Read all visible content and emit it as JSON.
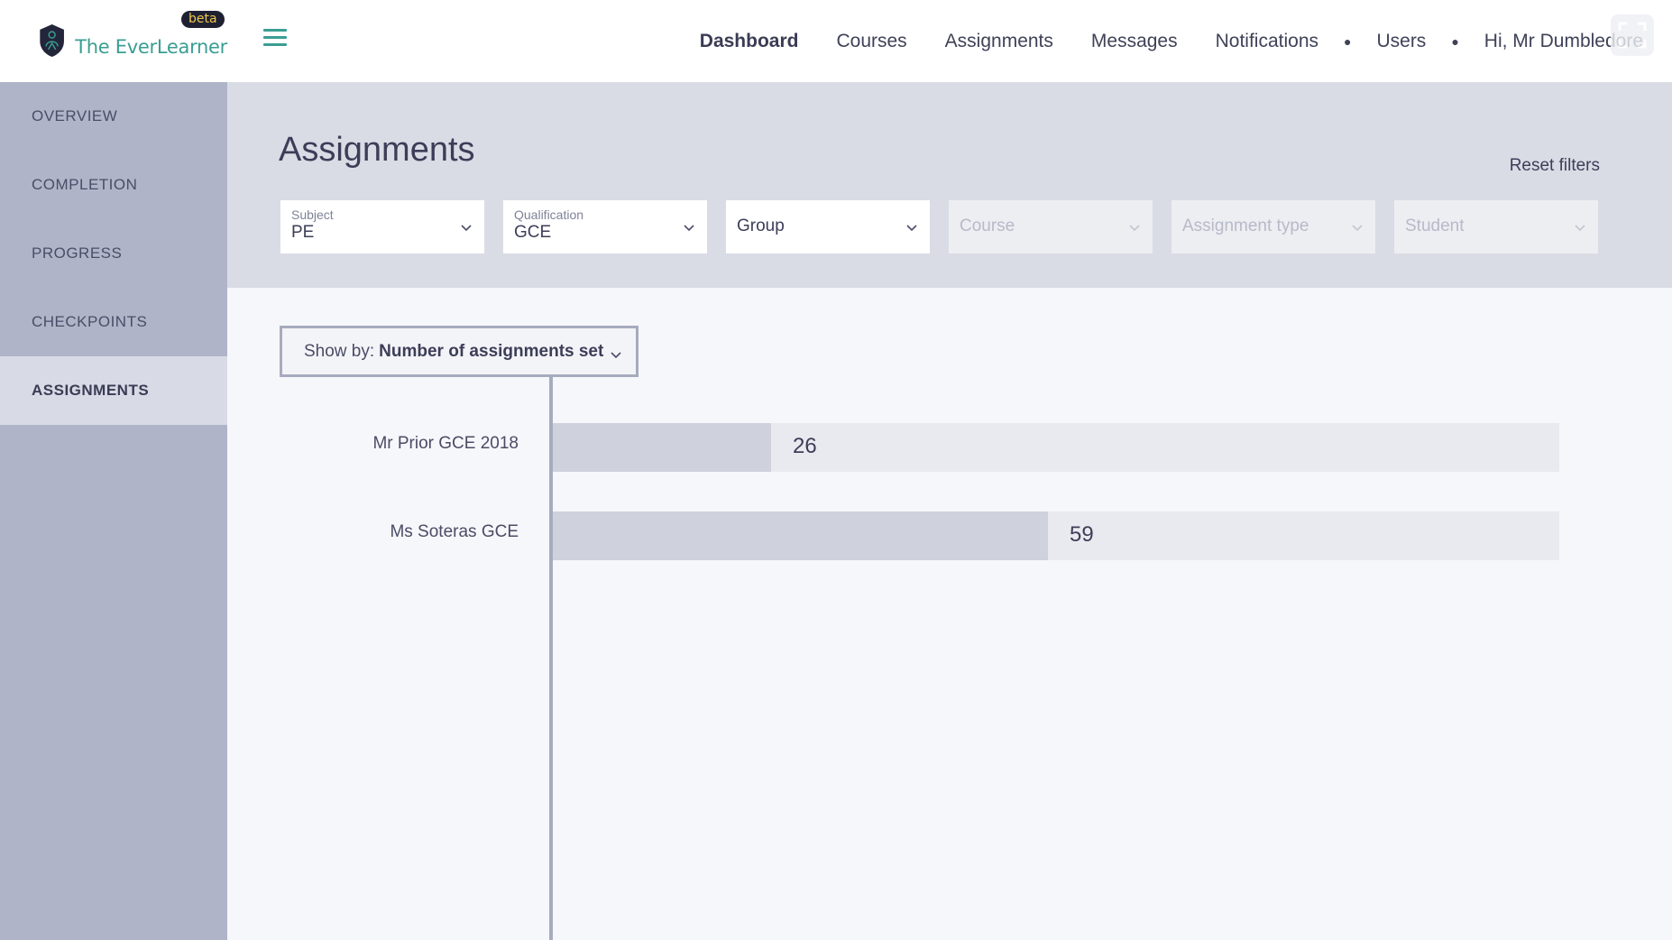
{
  "brand": {
    "name": "The EverLearner",
    "badge": "beta"
  },
  "nav": {
    "items": [
      {
        "label": "Dashboard",
        "active": true
      },
      {
        "label": "Courses"
      },
      {
        "label": "Assignments"
      },
      {
        "label": "Messages"
      },
      {
        "label": "Notifications"
      }
    ],
    "users": "Users",
    "greeting": "Hi, Mr Dumbledore"
  },
  "sidebar": {
    "items": [
      {
        "label": "OVERVIEW"
      },
      {
        "label": "COMPLETION"
      },
      {
        "label": "PROGRESS"
      },
      {
        "label": "CHECKPOINTS"
      },
      {
        "label": "ASSIGNMENTS",
        "active": true
      }
    ]
  },
  "page": {
    "title": "Assignments",
    "reset_filters": "Reset filters"
  },
  "filters": {
    "subject": {
      "label": "Subject",
      "value": "PE"
    },
    "qualification": {
      "label": "Qualification",
      "value": "GCE"
    },
    "group": {
      "placeholder": "Group"
    },
    "course": {
      "placeholder": "Course"
    },
    "assignment_type": {
      "placeholder": "Assignment type"
    },
    "student": {
      "placeholder": "Student"
    }
  },
  "show_by": {
    "prefix": "Show by:",
    "value": "Number of assignments set"
  },
  "chart_data": {
    "type": "bar",
    "orientation": "horizontal",
    "categories": [
      "Mr Prior GCE 2018",
      "Ms Soteras GCE"
    ],
    "values": [
      26,
      59
    ],
    "xlim": [
      0,
      120
    ],
    "title": "",
    "xlabel": "",
    "ylabel": ""
  },
  "colors": {
    "accent": "#3a9e93",
    "sidebar": "#b0b4c9",
    "bar_fill": "#cfd1dd",
    "bar_track": "#e9eaef"
  }
}
